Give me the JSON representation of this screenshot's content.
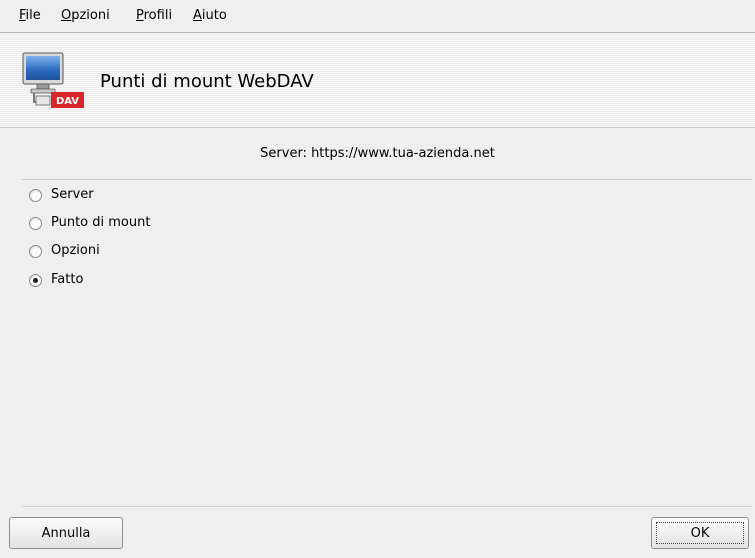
{
  "menu": {
    "items": [
      {
        "accel": "F",
        "rest": "ile"
      },
      {
        "accel": "O",
        "rest": "pzioni"
      },
      {
        "accel": "P",
        "rest": "rofili"
      },
      {
        "accel": "A",
        "rest": "iuto"
      }
    ]
  },
  "header": {
    "title": "Punti di mount WebDAV",
    "icon_badge": "DAV",
    "icon": "webdav-monitor-icon"
  },
  "server_line": "Server: https://www.tua-azienda.net",
  "steps": [
    {
      "label": "Server",
      "selected": false
    },
    {
      "label": "Punto di mount",
      "selected": false
    },
    {
      "label": "Opzioni",
      "selected": false
    },
    {
      "label": "Fatto",
      "selected": true
    }
  ],
  "buttons": {
    "cancel": "Annulla",
    "ok": "OK"
  }
}
